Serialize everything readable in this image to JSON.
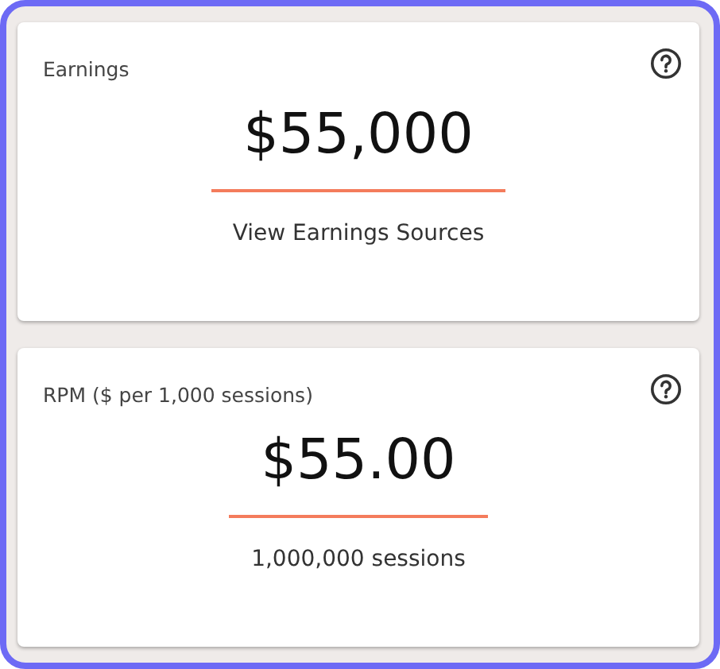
{
  "cards": [
    {
      "title": "Earnings",
      "value": "$55,000",
      "footer": "View Earnings Sources"
    },
    {
      "title": "RPM ($ per 1,000 sessions)",
      "value": "$55.00",
      "footer": "1,000,000 sessions"
    }
  ]
}
